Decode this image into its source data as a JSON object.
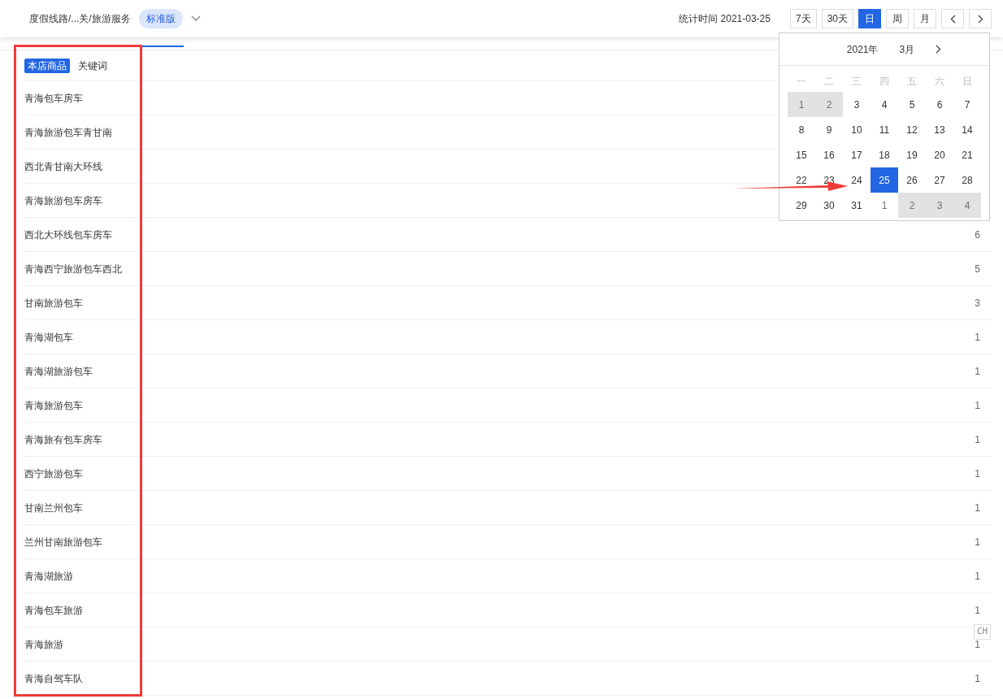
{
  "header": {
    "breadcrumb": "度假线路/...关/旅游服务",
    "edition_badge": "标准版",
    "stat_label": "统计时间 2021-03-25",
    "range_buttons": [
      {
        "label": "7天",
        "selected": false
      },
      {
        "label": "30天",
        "selected": false
      },
      {
        "label": "日",
        "selected": true
      },
      {
        "label": "周",
        "selected": false
      },
      {
        "label": "月",
        "selected": false
      }
    ]
  },
  "source_tabs": [
    {
      "label": "本店商品",
      "selected": true
    },
    {
      "label": "关键词",
      "selected": false
    }
  ],
  "rows": [
    {
      "name": "青海包车房车"
    },
    {
      "name": "青海旅游包车青甘南"
    },
    {
      "name": "西北青甘南大环线"
    },
    {
      "name": "青海旅游包车房车"
    },
    {
      "name": "西北大环线包车房车",
      "count": "6"
    },
    {
      "name": "青海西宁旅游包车西北",
      "count": "5"
    },
    {
      "name": "甘南旅游包车",
      "count": "3"
    },
    {
      "name": "青海湖包车",
      "count": "1"
    },
    {
      "name": "青海湖旅游包车",
      "count": "1"
    },
    {
      "name": "青海旅游包车",
      "count": "1"
    },
    {
      "name": "青海旅有包车房车",
      "count": "1"
    },
    {
      "name": "西宁旅游包车",
      "count": "1"
    },
    {
      "name": "甘南兰州包车",
      "count": "1"
    },
    {
      "name": "兰州甘南旅游包车",
      "count": "1"
    },
    {
      "name": "青海湖旅游",
      "count": "1"
    },
    {
      "name": "青海包车旅游",
      "count": "1"
    },
    {
      "name": "青海旅游",
      "count": "1"
    },
    {
      "name": "青海自驾车队",
      "count": "1"
    }
  ],
  "calendar": {
    "year": "2021年",
    "month": "3月",
    "weekdays": [
      "一",
      "二",
      "三",
      "四",
      "五",
      "六",
      "日"
    ],
    "days": [
      {
        "label": "1",
        "outside": true,
        "shaded": true,
        "selected": false
      },
      {
        "label": "2",
        "outside": true,
        "shaded": true,
        "selected": false
      },
      {
        "label": "3",
        "outside": false,
        "shaded": false,
        "selected": false
      },
      {
        "label": "4",
        "outside": false,
        "shaded": false,
        "selected": false
      },
      {
        "label": "5",
        "outside": false,
        "shaded": false,
        "selected": false
      },
      {
        "label": "6",
        "outside": false,
        "shaded": false,
        "selected": false
      },
      {
        "label": "7",
        "outside": false,
        "shaded": false,
        "selected": false
      },
      {
        "label": "8",
        "outside": false,
        "shaded": false,
        "selected": false
      },
      {
        "label": "9",
        "outside": false,
        "shaded": false,
        "selected": false
      },
      {
        "label": "10",
        "outside": false,
        "shaded": false,
        "selected": false
      },
      {
        "label": "11",
        "outside": false,
        "shaded": false,
        "selected": false
      },
      {
        "label": "12",
        "outside": false,
        "shaded": false,
        "selected": false
      },
      {
        "label": "13",
        "outside": false,
        "shaded": false,
        "selected": false
      },
      {
        "label": "14",
        "outside": false,
        "shaded": false,
        "selected": false
      },
      {
        "label": "15",
        "outside": false,
        "shaded": false,
        "selected": false
      },
      {
        "label": "16",
        "outside": false,
        "shaded": false,
        "selected": false
      },
      {
        "label": "17",
        "outside": false,
        "shaded": false,
        "selected": false
      },
      {
        "label": "18",
        "outside": false,
        "shaded": false,
        "selected": false
      },
      {
        "label": "19",
        "outside": false,
        "shaded": false,
        "selected": false
      },
      {
        "label": "20",
        "outside": false,
        "shaded": false,
        "selected": false
      },
      {
        "label": "21",
        "outside": false,
        "shaded": false,
        "selected": false
      },
      {
        "label": "22",
        "outside": false,
        "shaded": false,
        "selected": false
      },
      {
        "label": "23",
        "outside": false,
        "shaded": false,
        "selected": false
      },
      {
        "label": "24",
        "outside": false,
        "shaded": false,
        "selected": false
      },
      {
        "label": "25",
        "outside": false,
        "shaded": false,
        "selected": true
      },
      {
        "label": "26",
        "outside": false,
        "shaded": false,
        "selected": false
      },
      {
        "label": "27",
        "outside": false,
        "shaded": false,
        "selected": false
      },
      {
        "label": "28",
        "outside": false,
        "shaded": false,
        "selected": false
      },
      {
        "label": "29",
        "outside": false,
        "shaded": false,
        "selected": false
      },
      {
        "label": "30",
        "outside": false,
        "shaded": false,
        "selected": false
      },
      {
        "label": "31",
        "outside": false,
        "shaded": false,
        "selected": false
      },
      {
        "label": "1",
        "outside": true,
        "shaded": false,
        "selected": false
      },
      {
        "label": "2",
        "outside": true,
        "shaded": true,
        "selected": false
      },
      {
        "label": "3",
        "outside": true,
        "shaded": true,
        "selected": false
      },
      {
        "label": "4",
        "outside": true,
        "shaded": true,
        "selected": false
      }
    ]
  },
  "ime_badge": "CH"
}
